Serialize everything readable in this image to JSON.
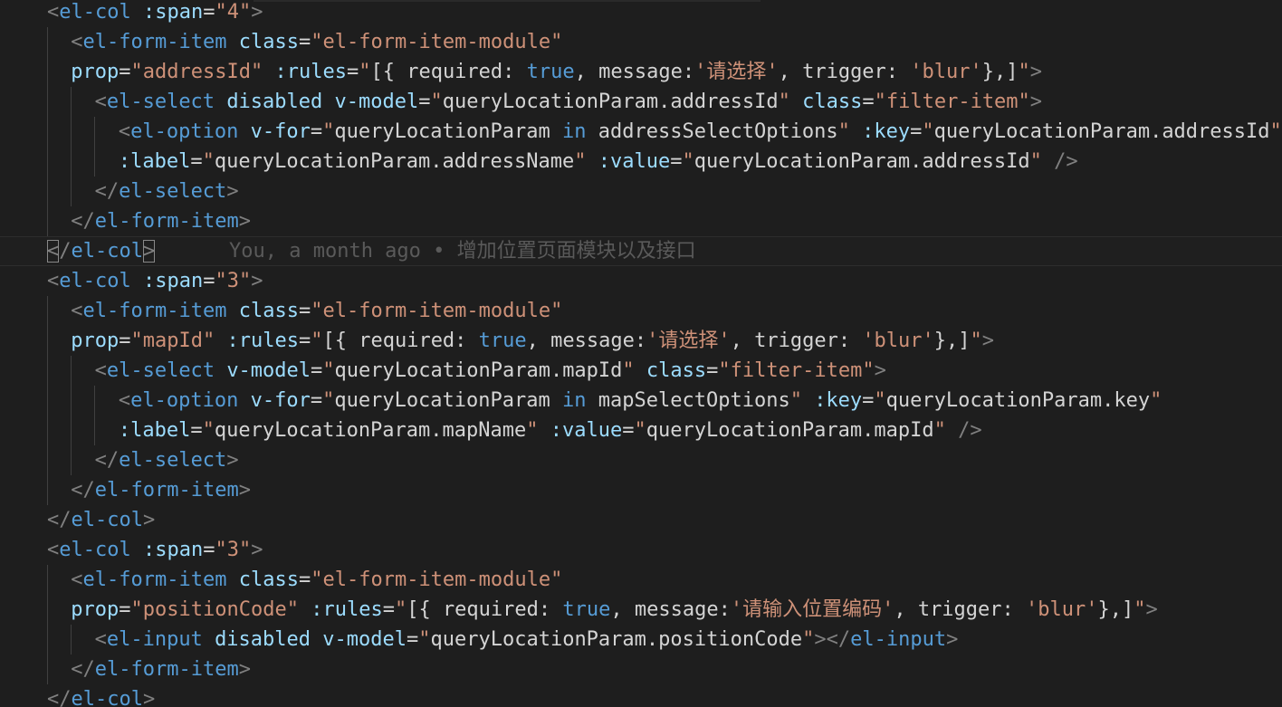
{
  "editor": {
    "lines": [
      {
        "tokens": [
          [
            "t-punct",
            "<"
          ],
          [
            "t-tag",
            "el-col"
          ],
          [
            "t-text",
            " "
          ],
          [
            "t-attr",
            ":span"
          ],
          [
            "t-op",
            "="
          ],
          [
            "t-str",
            "\"4\""
          ],
          [
            "t-punct",
            ">"
          ]
        ]
      },
      {
        "tokens": [
          [
            "t-punct",
            "<"
          ],
          [
            "t-tag",
            "el-form-item"
          ],
          [
            "t-text",
            " "
          ],
          [
            "t-attr",
            "class"
          ],
          [
            "t-op",
            "="
          ],
          [
            "t-str",
            "\"el-form-item-module\""
          ]
        ]
      },
      {
        "tokens": [
          [
            "t-attr",
            "prop"
          ],
          [
            "t-op",
            "="
          ],
          [
            "t-str",
            "\"addressId\""
          ],
          [
            "t-text",
            " "
          ],
          [
            "t-attr",
            ":rules"
          ],
          [
            "t-op",
            "="
          ],
          [
            "t-str",
            "\""
          ],
          [
            "t-text",
            "[{ required: "
          ],
          [
            "t-kw",
            "true"
          ],
          [
            "t-text",
            ", message:"
          ],
          [
            "t-str",
            "'请选择'"
          ],
          [
            "t-text",
            ", trigger: "
          ],
          [
            "t-str",
            "'blur'"
          ],
          [
            "t-text",
            "},]"
          ],
          [
            "t-str",
            "\""
          ],
          [
            "t-punct",
            ">"
          ]
        ]
      },
      {
        "tokens": [
          [
            "t-punct",
            "<"
          ],
          [
            "t-tag",
            "el-select"
          ],
          [
            "t-text",
            " "
          ],
          [
            "t-attr",
            "disabled"
          ],
          [
            "t-text",
            " "
          ],
          [
            "t-attr",
            "v-model"
          ],
          [
            "t-op",
            "="
          ],
          [
            "t-str",
            "\""
          ],
          [
            "t-text",
            "queryLocationParam.addressId"
          ],
          [
            "t-str",
            "\""
          ],
          [
            "t-text",
            " "
          ],
          [
            "t-attr",
            "class"
          ],
          [
            "t-op",
            "="
          ],
          [
            "t-str",
            "\"filter-item\""
          ],
          [
            "t-punct",
            ">"
          ]
        ]
      },
      {
        "tokens": [
          [
            "t-punct",
            "<"
          ],
          [
            "t-tag",
            "el-option"
          ],
          [
            "t-text",
            " "
          ],
          [
            "t-attr",
            "v-for"
          ],
          [
            "t-op",
            "="
          ],
          [
            "t-str",
            "\""
          ],
          [
            "t-text",
            "queryLocationParam "
          ],
          [
            "t-kw",
            "in"
          ],
          [
            "t-text",
            " addressSelectOptions"
          ],
          [
            "t-str",
            "\""
          ],
          [
            "t-text",
            " "
          ],
          [
            "t-attr",
            ":key"
          ],
          [
            "t-op",
            "="
          ],
          [
            "t-str",
            "\""
          ],
          [
            "t-text",
            "queryLocationParam.addressId"
          ],
          [
            "t-str",
            "\""
          ]
        ]
      },
      {
        "tokens": [
          [
            "t-attr",
            ":label"
          ],
          [
            "t-op",
            "="
          ],
          [
            "t-str",
            "\""
          ],
          [
            "t-text",
            "queryLocationParam.addressName"
          ],
          [
            "t-str",
            "\""
          ],
          [
            "t-text",
            " "
          ],
          [
            "t-attr",
            ":value"
          ],
          [
            "t-op",
            "="
          ],
          [
            "t-str",
            "\""
          ],
          [
            "t-text",
            "queryLocationParam.addressId"
          ],
          [
            "t-str",
            "\""
          ],
          [
            "t-text",
            " "
          ],
          [
            "t-punct",
            "/>"
          ]
        ]
      },
      {
        "tokens": [
          [
            "t-punct",
            "</"
          ],
          [
            "t-tag",
            "el-select"
          ],
          [
            "t-punct",
            ">"
          ]
        ]
      },
      {
        "tokens": [
          [
            "t-punct",
            "</"
          ],
          [
            "t-tag",
            "el-form-item"
          ],
          [
            "t-punct",
            ">"
          ]
        ]
      },
      {
        "tokens": [
          [
            "t-punct box",
            "<"
          ],
          [
            "t-punct",
            "/"
          ],
          [
            "t-tag",
            "el-col"
          ],
          [
            "t-punct box",
            ">"
          ]
        ],
        "blame": "You, a month ago • 增加位置页面模块以及接口"
      },
      {
        "tokens": [
          [
            "t-punct",
            "<"
          ],
          [
            "t-tag",
            "el-col"
          ],
          [
            "t-text",
            " "
          ],
          [
            "t-attr",
            ":span"
          ],
          [
            "t-op",
            "="
          ],
          [
            "t-str",
            "\"3\""
          ],
          [
            "t-punct",
            ">"
          ]
        ]
      },
      {
        "tokens": [
          [
            "t-punct",
            "<"
          ],
          [
            "t-tag",
            "el-form-item"
          ],
          [
            "t-text",
            " "
          ],
          [
            "t-attr",
            "class"
          ],
          [
            "t-op",
            "="
          ],
          [
            "t-str",
            "\"el-form-item-module\""
          ]
        ]
      },
      {
        "tokens": [
          [
            "t-attr",
            "prop"
          ],
          [
            "t-op",
            "="
          ],
          [
            "t-str",
            "\"mapId\""
          ],
          [
            "t-text",
            " "
          ],
          [
            "t-attr",
            ":rules"
          ],
          [
            "t-op",
            "="
          ],
          [
            "t-str",
            "\""
          ],
          [
            "t-text",
            "[{ required: "
          ],
          [
            "t-kw",
            "true"
          ],
          [
            "t-text",
            ", message:"
          ],
          [
            "t-str",
            "'请选择'"
          ],
          [
            "t-text",
            ", trigger: "
          ],
          [
            "t-str",
            "'blur'"
          ],
          [
            "t-text",
            "},]"
          ],
          [
            "t-str",
            "\""
          ],
          [
            "t-punct",
            ">"
          ]
        ]
      },
      {
        "tokens": [
          [
            "t-punct",
            "<"
          ],
          [
            "t-tag",
            "el-select"
          ],
          [
            "t-text",
            " "
          ],
          [
            "t-attr",
            "v-model"
          ],
          [
            "t-op",
            "="
          ],
          [
            "t-str",
            "\""
          ],
          [
            "t-text",
            "queryLocationParam.mapId"
          ],
          [
            "t-str",
            "\""
          ],
          [
            "t-text",
            " "
          ],
          [
            "t-attr",
            "class"
          ],
          [
            "t-op",
            "="
          ],
          [
            "t-str",
            "\"filter-item\""
          ],
          [
            "t-punct",
            ">"
          ]
        ]
      },
      {
        "tokens": [
          [
            "t-punct",
            "<"
          ],
          [
            "t-tag",
            "el-option"
          ],
          [
            "t-text",
            " "
          ],
          [
            "t-attr",
            "v-for"
          ],
          [
            "t-op",
            "="
          ],
          [
            "t-str",
            "\""
          ],
          [
            "t-text",
            "queryLocationParam "
          ],
          [
            "t-kw",
            "in"
          ],
          [
            "t-text",
            " mapSelectOptions"
          ],
          [
            "t-str",
            "\""
          ],
          [
            "t-text",
            " "
          ],
          [
            "t-attr",
            ":key"
          ],
          [
            "t-op",
            "="
          ],
          [
            "t-str",
            "\""
          ],
          [
            "t-text",
            "queryLocationParam.key"
          ],
          [
            "t-str",
            "\""
          ]
        ]
      },
      {
        "tokens": [
          [
            "t-attr",
            ":label"
          ],
          [
            "t-op",
            "="
          ],
          [
            "t-str",
            "\""
          ],
          [
            "t-text",
            "queryLocationParam.mapName"
          ],
          [
            "t-str",
            "\""
          ],
          [
            "t-text",
            " "
          ],
          [
            "t-attr",
            ":value"
          ],
          [
            "t-op",
            "="
          ],
          [
            "t-str",
            "\""
          ],
          [
            "t-text",
            "queryLocationParam.mapId"
          ],
          [
            "t-str",
            "\""
          ],
          [
            "t-text",
            " "
          ],
          [
            "t-punct",
            "/>"
          ]
        ]
      },
      {
        "tokens": [
          [
            "t-punct",
            "</"
          ],
          [
            "t-tag",
            "el-select"
          ],
          [
            "t-punct",
            ">"
          ]
        ]
      },
      {
        "tokens": [
          [
            "t-punct",
            "</"
          ],
          [
            "t-tag",
            "el-form-item"
          ],
          [
            "t-punct",
            ">"
          ]
        ]
      },
      {
        "tokens": [
          [
            "t-punct",
            "</"
          ],
          [
            "t-tag",
            "el-col"
          ],
          [
            "t-punct",
            ">"
          ]
        ]
      },
      {
        "tokens": [
          [
            "t-punct",
            "<"
          ],
          [
            "t-tag",
            "el-col"
          ],
          [
            "t-text",
            " "
          ],
          [
            "t-attr",
            ":span"
          ],
          [
            "t-op",
            "="
          ],
          [
            "t-str",
            "\"3\""
          ],
          [
            "t-punct",
            ">"
          ]
        ]
      },
      {
        "tokens": [
          [
            "t-punct",
            "<"
          ],
          [
            "t-tag",
            "el-form-item"
          ],
          [
            "t-text",
            " "
          ],
          [
            "t-attr",
            "class"
          ],
          [
            "t-op",
            "="
          ],
          [
            "t-str",
            "\"el-form-item-module\""
          ]
        ]
      },
      {
        "tokens": [
          [
            "t-attr",
            "prop"
          ],
          [
            "t-op",
            "="
          ],
          [
            "t-str",
            "\"positionCode\""
          ],
          [
            "t-text",
            " "
          ],
          [
            "t-attr",
            ":rules"
          ],
          [
            "t-op",
            "="
          ],
          [
            "t-str",
            "\""
          ],
          [
            "t-text",
            "[{ required: "
          ],
          [
            "t-kw",
            "true"
          ],
          [
            "t-text",
            ", message:"
          ],
          [
            "t-str",
            "'请输入位置编码'"
          ],
          [
            "t-text",
            ", trigger: "
          ],
          [
            "t-str",
            "'blur'"
          ],
          [
            "t-text",
            "},]"
          ],
          [
            "t-str",
            "\""
          ],
          [
            "t-punct",
            ">"
          ]
        ]
      },
      {
        "tokens": [
          [
            "t-punct",
            "<"
          ],
          [
            "t-tag",
            "el-input"
          ],
          [
            "t-text",
            " "
          ],
          [
            "t-attr",
            "disabled"
          ],
          [
            "t-text",
            " "
          ],
          [
            "t-attr",
            "v-model"
          ],
          [
            "t-op",
            "="
          ],
          [
            "t-str",
            "\""
          ],
          [
            "t-text",
            "queryLocationParam.positionCode"
          ],
          [
            "t-str",
            "\""
          ],
          [
            "t-punct",
            "></"
          ],
          [
            "t-tag",
            "el-input"
          ],
          [
            "t-punct",
            ">"
          ]
        ]
      },
      {
        "tokens": [
          [
            "t-punct",
            "</"
          ],
          [
            "t-tag",
            "el-form-item"
          ],
          [
            "t-punct",
            ">"
          ]
        ]
      },
      {
        "tokens": [
          [
            "t-punct",
            "</"
          ],
          [
            "t-tag",
            "el-col"
          ],
          [
            "t-punct",
            ">"
          ]
        ]
      }
    ]
  }
}
